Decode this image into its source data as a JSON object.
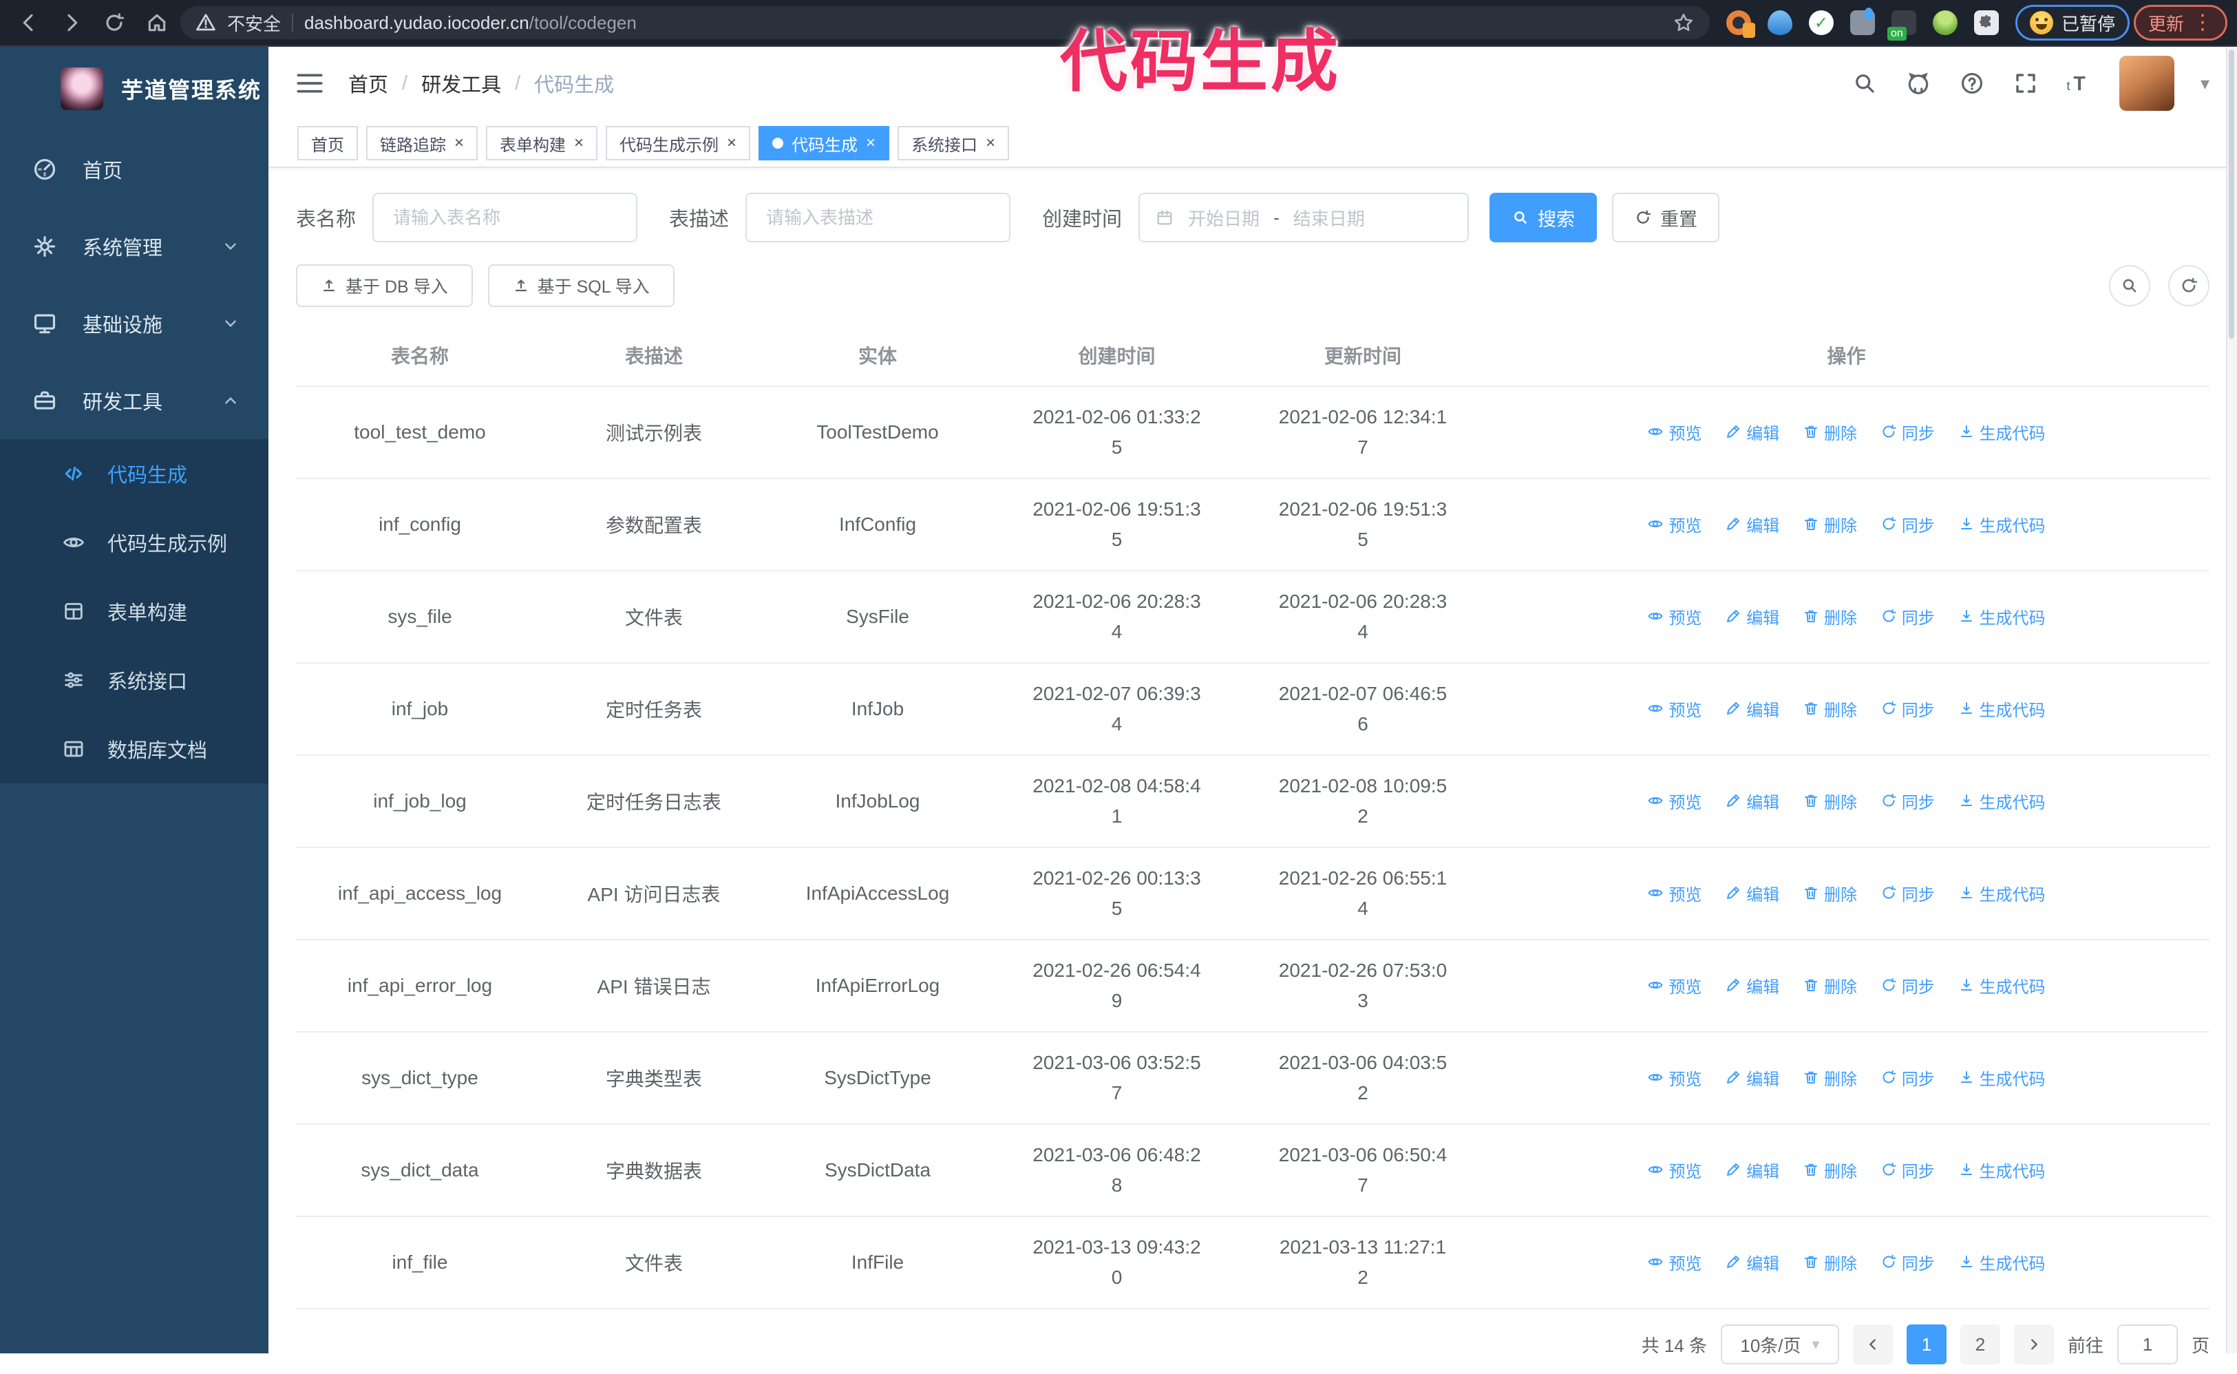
{
  "colors": {
    "accent": "#409eff",
    "chrome_bar_bg": "#1d232c",
    "sidebar_bg": "#234765",
    "submenu_bg": "#1c3a55",
    "annotation": "#ef2e63"
  },
  "icons": {
    "close": "×",
    "caret_down": "▾",
    "kebab": "⋮",
    "breadcrumb_separator": "/",
    "date_separator": "-"
  },
  "browser": {
    "security_label": "不安全",
    "url_domain": "dashboard.yudao.iocoder.cn",
    "url_path": "/tool/codegen",
    "extension_badge_on": "on",
    "paused_badge": "已暂停",
    "update_button": "更新"
  },
  "annotation": {
    "text": "代码生成"
  },
  "sidebar": {
    "title": "芋道管理系统",
    "items": [
      {
        "label": "首页"
      },
      {
        "label": "系统管理"
      },
      {
        "label": "基础设施"
      },
      {
        "label": "研发工具"
      }
    ],
    "submenu": [
      {
        "label": "代码生成"
      },
      {
        "label": "代码生成示例"
      },
      {
        "label": "表单构建"
      },
      {
        "label": "系统接口"
      },
      {
        "label": "数据库文档"
      }
    ]
  },
  "breadcrumb": [
    "首页",
    "研发工具",
    "代码生成"
  ],
  "tabs": [
    {
      "label": "首页"
    },
    {
      "label": "链路追踪"
    },
    {
      "label": "表单构建"
    },
    {
      "label": "代码生成示例"
    },
    {
      "label": "代码生成"
    },
    {
      "label": "系统接口"
    }
  ],
  "filters": {
    "table_name_label": "表名称",
    "table_name_placeholder": "请输入表名称",
    "table_desc_label": "表描述",
    "table_desc_placeholder": "请输入表描述",
    "create_time_label": "创建时间",
    "start_placeholder": "开始日期",
    "end_placeholder": "结束日期",
    "search_label": "搜索",
    "reset_label": "重置"
  },
  "toolbar": {
    "import_db_label": "基于 DB 导入",
    "import_sql_label": "基于 SQL 导入"
  },
  "table": {
    "columns": [
      "表名称",
      "表描述",
      "实体",
      "创建时间",
      "更新时间",
      "操作"
    ],
    "actions": [
      {
        "label": "预览",
        "icon": "eye"
      },
      {
        "label": "编辑",
        "icon": "pencil"
      },
      {
        "label": "删除",
        "icon": "trash"
      },
      {
        "label": "同步",
        "icon": "sync"
      },
      {
        "label": "生成代码",
        "icon": "download"
      }
    ],
    "rows": [
      {
        "name": "tool_test_demo",
        "desc": "测试示例表",
        "entity": "ToolTestDemo",
        "created": "2021-02-06 01:33:25",
        "updated": "2021-02-06 12:34:17"
      },
      {
        "name": "inf_config",
        "desc": "参数配置表",
        "entity": "InfConfig",
        "created": "2021-02-06 19:51:35",
        "updated": "2021-02-06 19:51:35"
      },
      {
        "name": "sys_file",
        "desc": "文件表",
        "entity": "SysFile",
        "created": "2021-02-06 20:28:34",
        "updated": "2021-02-06 20:28:34"
      },
      {
        "name": "inf_job",
        "desc": "定时任务表",
        "entity": "InfJob",
        "created": "2021-02-07 06:39:34",
        "updated": "2021-02-07 06:46:56"
      },
      {
        "name": "inf_job_log",
        "desc": "定时任务日志表",
        "entity": "InfJobLog",
        "created": "2021-02-08 04:58:41",
        "updated": "2021-02-08 10:09:52"
      },
      {
        "name": "inf_api_access_log",
        "desc": "API 访问日志表",
        "entity": "InfApiAccessLog",
        "created": "2021-02-26 00:13:35",
        "updated": "2021-02-26 06:55:14"
      },
      {
        "name": "inf_api_error_log",
        "desc": "API 错误日志",
        "entity": "InfApiErrorLog",
        "created": "2021-02-26 06:54:49",
        "updated": "2021-02-26 07:53:03"
      },
      {
        "name": "sys_dict_type",
        "desc": "字典类型表",
        "entity": "SysDictType",
        "created": "2021-03-06 03:52:57",
        "updated": "2021-03-06 04:03:52"
      },
      {
        "name": "sys_dict_data",
        "desc": "字典数据表",
        "entity": "SysDictData",
        "created": "2021-03-06 06:48:28",
        "updated": "2021-03-06 06:50:47"
      },
      {
        "name": "inf_file",
        "desc": "文件表",
        "entity": "InfFile",
        "created": "2021-03-13 09:43:20",
        "updated": "2021-03-13 11:27:12"
      }
    ]
  },
  "pagination": {
    "total": "共 14 条",
    "page_size": "10条/页",
    "pages": [
      "1",
      "2"
    ],
    "active_page": "1",
    "goto_label": "前往",
    "goto_value": "1",
    "page_unit": "页"
  }
}
